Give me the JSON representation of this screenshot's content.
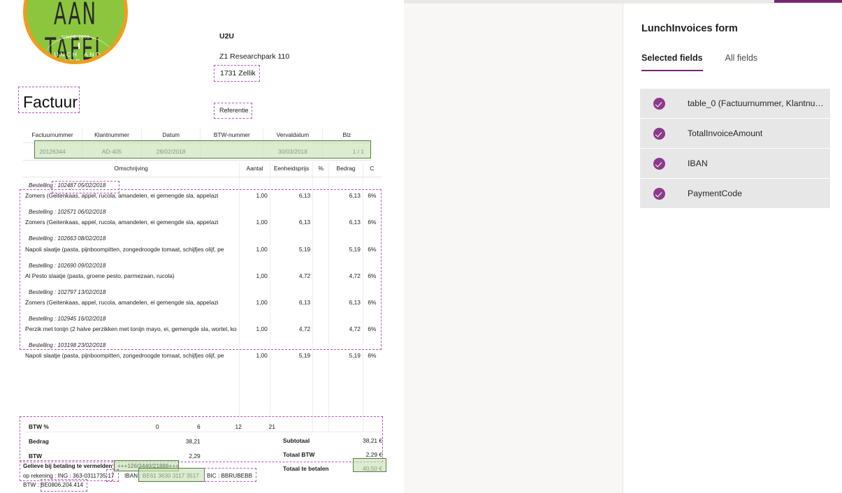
{
  "document": {
    "logo": {
      "name": "AAN TAFEL",
      "since": "SINCE 2003",
      "tagline": "LUNCH AND CATERING",
      "circle_color": "#8cc63e",
      "ring_color": "#f29b1d"
    },
    "title": "Factuur",
    "recipient": {
      "name": "U2U",
      "street": "Z1 Researchpark 110",
      "city": "1731 Zellik"
    },
    "reference_label": "Referentie",
    "header_table": {
      "columns": [
        "Factuurnummer",
        "Klantnummer",
        "Datum",
        "BTW-nummer",
        "Vervaldatum",
        "Blz"
      ],
      "row": [
        "20126344",
        "AD-405",
        "28/02/2018",
        "",
        "30/03/2018",
        "1 / 1"
      ]
    },
    "lines_table": {
      "columns": [
        "Omschrijving",
        "Aantal",
        "Eenheidsprijs",
        "%",
        "Bedrag",
        "C"
      ],
      "rows": [
        {
          "order": "Bestelling : 102487   05/02/2018",
          "description": "Zomers (Geitenkaas, appel, rucola, amandelen, ei gemengde sla, appelazi",
          "qty": "1,00",
          "unit_price": "6,13",
          "pct": "",
          "amount": "6,13",
          "c": "6%"
        },
        {
          "order": "Bestelling : 102571   06/02/2018",
          "description": "Zomers (Geitenkaas, appel, rucola, amandelen, ei gemengde sla, appelazi",
          "qty": "1,00",
          "unit_price": "6,13",
          "pct": "",
          "amount": "6,13",
          "c": "6%"
        },
        {
          "order": "Bestelling : 102663   08/02/2018",
          "description": "Napoli slaatje (pasta, pijnboompitten, zongedroogde tomaat, schijfjes olijf, pe",
          "qty": "1,00",
          "unit_price": "5,19",
          "pct": "",
          "amount": "5,19",
          "c": "6%"
        },
        {
          "order": "Bestelling : 102690   09/02/2018",
          "description": "Al Pesto slaatje (pasta, groene pesto, parmezaan, rucola)",
          "qty": "1,00",
          "unit_price": "4,72",
          "pct": "",
          "amount": "4,72",
          "c": "6%"
        },
        {
          "order": "Bestelling : 102797   13/02/2018",
          "description": "Zomers (Geitenkaas, appel, rucola, amandelen, ei gemengde sla, appelazi",
          "qty": "1,00",
          "unit_price": "6,13",
          "pct": "",
          "amount": "6,13",
          "c": "6%"
        },
        {
          "order": "Bestelling : 102945   16/02/2018",
          "description": "Perzik met tonijn (2 halve perzikken met tonijn mayo, ei, gemengde sla, wortel, ko",
          "qty": "1,00",
          "unit_price": "4,72",
          "pct": "",
          "amount": "4,72",
          "c": "6%"
        },
        {
          "order": "Bestelling : 103198   23/02/2018",
          "description": "Napoli slaatje (pasta, pijnboompitten, zongedroogde tomaat, schijfjes olijf, pe",
          "qty": "1,00",
          "unit_price": "5,19",
          "pct": "",
          "amount": "5,19",
          "c": "6%"
        }
      ]
    },
    "vat_summary": {
      "row_labels": [
        "BTW %",
        "Bedrag",
        "BTW"
      ],
      "rates": [
        "0",
        "6",
        "12",
        "21"
      ],
      "bedrag": [
        "",
        "38,21",
        "",
        ""
      ],
      "btw": [
        "",
        "2,29",
        "",
        ""
      ]
    },
    "totals": [
      {
        "label": "Subtotaal",
        "value": "38,21 €"
      },
      {
        "label": "Totaal BTW",
        "value": "2,29 €"
      },
      {
        "label": "Totaal te betalen",
        "value": "40,50 €"
      }
    ],
    "payment": {
      "note_label": "Gelieve bij betaling te vermelden :",
      "payment_code": "+++126/3440/21886+++",
      "account_label": "op rekening : ING : 363-0311735-17",
      "iban": "IBAN : BE61 3630 3117 3517",
      "bic": "BIC : BBRUBEBB",
      "vat_number": "BTW : BE0806.204.414"
    }
  },
  "sidebar": {
    "title": "LunchInvoices form",
    "tabs": [
      {
        "label": "Selected fields",
        "active": true
      },
      {
        "label": "All fields",
        "active": false
      }
    ],
    "fields": [
      {
        "label": "table_0 (Factuurnummer, Klantnumme…",
        "checked": true
      },
      {
        "label": "TotalInvoiceAmount",
        "checked": true
      },
      {
        "label": "IBAN",
        "checked": true
      },
      {
        "label": "PaymentCode",
        "checked": true
      }
    ]
  },
  "colors": {
    "accent_purple": "#742774",
    "selection_dashed": "#b256b2",
    "highlight_green_border": "#4e7f3c",
    "highlight_green_fill": "#c6e0b4",
    "check_icon": "#8c3a8c"
  }
}
